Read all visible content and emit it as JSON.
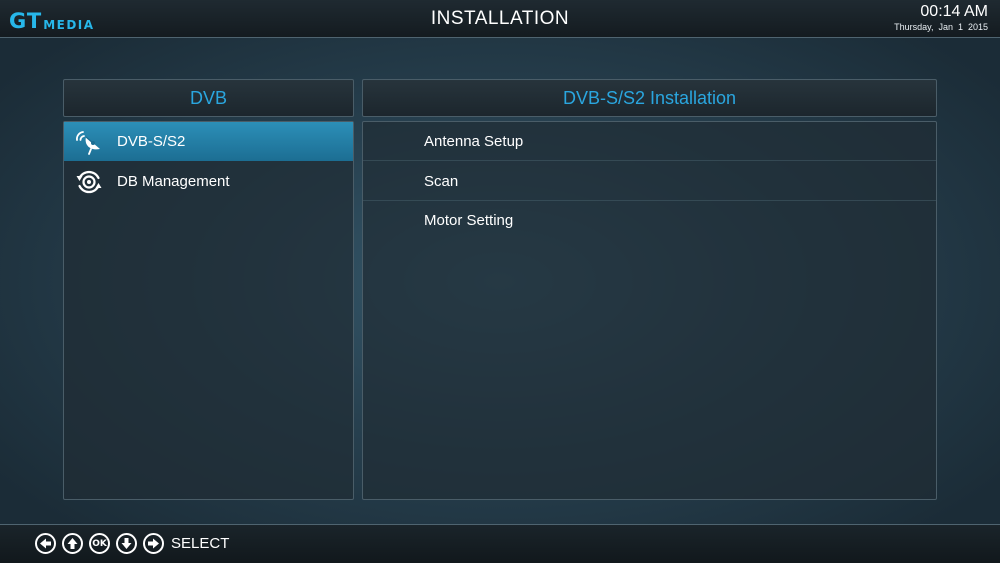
{
  "header": {
    "logo_primary": "GT",
    "logo_secondary": "MEDIA",
    "title": "INSTALLATION",
    "time": "00:14 AM",
    "date": "Thursday,  Jan  1  2015"
  },
  "left_panel": {
    "title": "DVB",
    "items": [
      {
        "label": "DVB-S/S2",
        "icon": "satellite-dish-icon",
        "selected": true
      },
      {
        "label": "DB Management",
        "icon": "database-refresh-icon",
        "selected": false
      }
    ]
  },
  "right_panel": {
    "title": "DVB-S/S2 Installation",
    "items": [
      {
        "label": "Antenna Setup"
      },
      {
        "label": "Scan"
      },
      {
        "label": "Motor Setting"
      }
    ]
  },
  "footer": {
    "keys": [
      "left-arrow-icon",
      "up-arrow-icon",
      "ok-icon",
      "down-arrow-icon",
      "right-arrow-icon"
    ],
    "ok_label": "OK",
    "hint": "SELECT"
  },
  "colors": {
    "accent": "#2aa6df",
    "logo": "#27b7ea",
    "selected_row": "#237fa6",
    "background": "#27404f"
  }
}
